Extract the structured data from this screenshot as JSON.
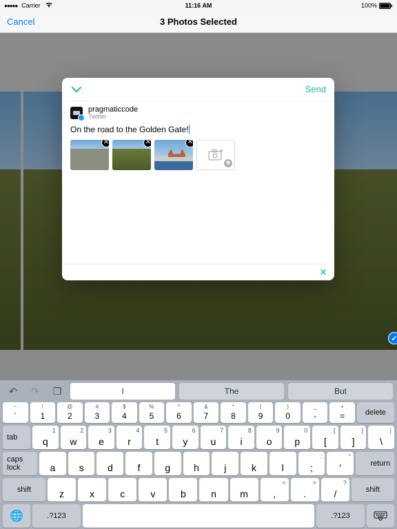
{
  "statusbar": {
    "carrier": "Carrier",
    "time": "11:16 AM",
    "battery": "100%"
  },
  "nav": {
    "cancel": "Cancel",
    "title": "3 Photos Selected"
  },
  "compose": {
    "send": "Send",
    "user": {
      "name": "pragmaticcode",
      "service": "Twitter"
    },
    "text": "On the road to the Golden Gate!"
  },
  "keyboard": {
    "suggestions": [
      "I",
      "The",
      "But"
    ],
    "numrow": [
      {
        "sym": "~",
        "n": "`"
      },
      {
        "sym": "!",
        "n": "1"
      },
      {
        "sym": "@",
        "n": "2"
      },
      {
        "sym": "#",
        "n": "3"
      },
      {
        "sym": "$",
        "n": "4"
      },
      {
        "sym": "%",
        "n": "5"
      },
      {
        "sym": "^",
        "n": "6"
      },
      {
        "sym": "&",
        "n": "7"
      },
      {
        "sym": "*",
        "n": "8"
      },
      {
        "sym": "(",
        "n": "9"
      },
      {
        "sym": ")",
        "n": "0"
      },
      {
        "sym": "_",
        "n": "-"
      },
      {
        "sym": "+",
        "n": "="
      }
    ],
    "delete": "delete",
    "row_q": [
      "q",
      "w",
      "e",
      "r",
      "t",
      "y",
      "u",
      "i",
      "o",
      "p"
    ],
    "row_q_tail": [
      {
        "k": "[",
        "a": "{"
      },
      {
        "k": "]",
        "a": "}"
      },
      {
        "k": "\\",
        "a": "|"
      }
    ],
    "row_a": [
      "a",
      "s",
      "d",
      "f",
      "g",
      "h",
      "j",
      "k",
      "l"
    ],
    "row_a_tail": [
      {
        "k": ";",
        "a": ":"
      },
      {
        "k": "'",
        "a": "\""
      }
    ],
    "row_z": [
      "z",
      "x",
      "c",
      "v",
      "b",
      "n",
      "m"
    ],
    "row_z_tail": [
      {
        "k": ",",
        "a": "<"
      },
      {
        "k": ".",
        "a": ">"
      },
      {
        "k": "/",
        "a": "?"
      }
    ],
    "tab": "tab",
    "caps": "caps lock",
    "return": "return",
    "shift": "shift",
    "sym": ".?123"
  }
}
